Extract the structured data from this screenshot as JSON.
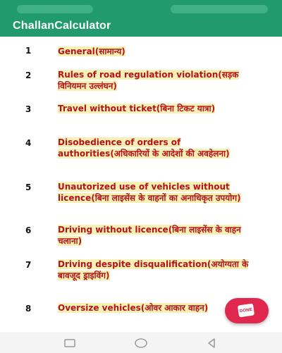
{
  "app": {
    "title": "ChallanCalculator"
  },
  "offenses": [
    {
      "number": "1",
      "label": "General(सामान्य)"
    },
    {
      "number": "2",
      "label": "Rules of road regulation violation(सड़क विनियमन उल्लंघन)"
    },
    {
      "number": "3",
      "label": "Travel without ticket(बिना टिकट यात्रा)"
    },
    {
      "number": "4",
      "label": "Disobedience of orders of authorities(अधिकारियों के आदेशों की अवहेलना)"
    },
    {
      "number": "5",
      "label": "Unautorized use of vehicles without licence(बिना लाइसेंस के वाहनों का अनाधिकृत उपयोग)"
    },
    {
      "number": "6",
      "label": "Driving without licence(बिना लाइसेंस के वाहन चलाना)"
    },
    {
      "number": "7",
      "label": "Driving despite disqualification(अयोग्यता के बावजूद ड्राइविंग)"
    },
    {
      "number": "8",
      "label": "Oversize vehicles(ओवर आकार वाहन)"
    }
  ],
  "fab": {
    "badge_text": "DONE",
    "icon": "done-stamp-icon"
  },
  "nav": {
    "back_icon": "back-triangle-icon",
    "home_icon": "home-circle-icon",
    "recents_icon": "recents-square-icon"
  },
  "colors": {
    "primary": "#219b6e",
    "item_text": "#b5121b",
    "item_highlight": "#f6f0b5",
    "fab": "#e0284f"
  }
}
